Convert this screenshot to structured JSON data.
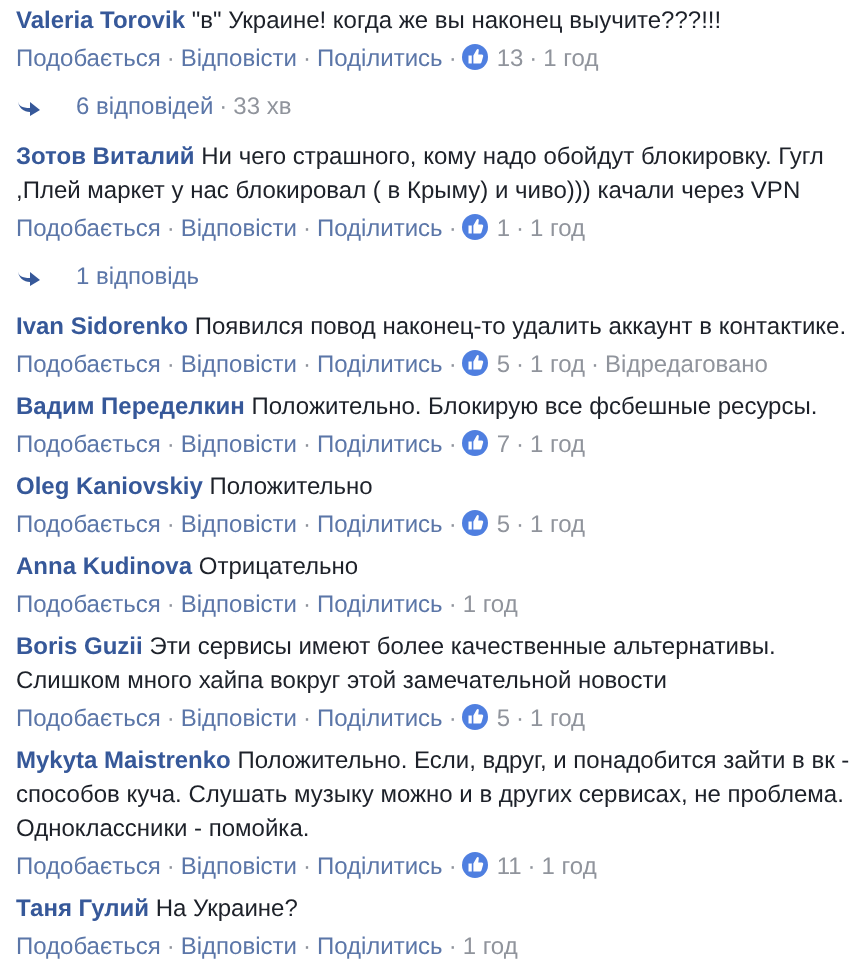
{
  "items": [
    {
      "kind": "comment",
      "author": "Valeria Torovik",
      "text": "\"в\" Украине! когда же вы наконец выучите???!!!",
      "actions": [
        "Подобається",
        "Відповісти",
        "Поділитись"
      ],
      "likes": "13",
      "time": "1 год",
      "separators": [
        "·",
        "·",
        "·",
        "·"
      ]
    },
    {
      "kind": "replies",
      "label": "6 відповідей",
      "time": "33 хв",
      "separators": [
        "·"
      ]
    },
    {
      "kind": "comment",
      "author": "Зотов Виталий",
      "text": "Ни чего страшного, кому надо обойдут блокировку. Гугл ,Плей маркет у нас блокировал ( в Крыму) и чиво))) качали через VPN",
      "actions": [
        "Подобається",
        "Відповісти",
        "Поділитись"
      ],
      "likes": "1",
      "time": "1 год",
      "separators": [
        "·",
        "·",
        "·",
        "·"
      ]
    },
    {
      "kind": "replies",
      "label": "1 відповідь"
    },
    {
      "kind": "comment",
      "author": "Ivan Sidorenko",
      "text": "Появился повод наконец-то удалить аккаунт в контактике.",
      "actions": [
        "Подобається",
        "Відповісти",
        "Поділитись"
      ],
      "likes": "5",
      "time": "1 год",
      "edited": "Відредаговано",
      "separators": [
        "·",
        "·",
        "·",
        "·",
        "·"
      ]
    },
    {
      "kind": "comment",
      "author": "Вадим Переделкин",
      "text": "Положительно. Блокирую все фсбешные ресурсы.",
      "actions": [
        "Подобається",
        "Відповісти",
        "Поділитись"
      ],
      "likes": "7",
      "time": "1 год",
      "separators": [
        "·",
        "·",
        "·",
        "·"
      ]
    },
    {
      "kind": "comment",
      "author": "Oleg Kaniovskiy",
      "text": "Положительно",
      "actions": [
        "Подобається",
        "Відповісти",
        "Поділитись"
      ],
      "likes": "5",
      "time": "1 год",
      "separators": [
        "·",
        "·",
        "·",
        "·"
      ]
    },
    {
      "kind": "comment",
      "author": "Anna Kudinova",
      "text": "Отрицательно",
      "actions": [
        "Подобається",
        "Відповісти",
        "Поділитись"
      ],
      "time": "1 год",
      "separators": [
        "·",
        "·",
        "·"
      ]
    },
    {
      "kind": "comment",
      "author": "Boris Guzii",
      "text": "Эти сервисы имеют более качественные альтернативы. Слишком много хайпа вокруг этой замечательной новости",
      "actions": [
        "Подобається",
        "Відповісти",
        "Поділитись"
      ],
      "likes": "5",
      "time": "1 год",
      "separators": [
        "·",
        "·",
        "·",
        "·"
      ]
    },
    {
      "kind": "comment",
      "author": "Mykyta Maistrenko",
      "text": "Положительно. Если, вдруг, и понадобится зайти в вк - способов куча. Слушать музыку можно и в других сервисах, не проблема. Одноклассники - помойка.",
      "actions": [
        "Подобається",
        "Відповісти",
        "Поділитись"
      ],
      "likes": "11",
      "time": "1 год",
      "separators": [
        "·",
        "·",
        "·",
        "·"
      ]
    },
    {
      "kind": "comment",
      "author": "Таня Гулий",
      "text": "На Украине?",
      "actions": [
        "Подобається",
        "Відповісти",
        "Поділитись"
      ],
      "time": "1 год",
      "separators": [
        "·",
        "·",
        "·"
      ]
    }
  ]
}
